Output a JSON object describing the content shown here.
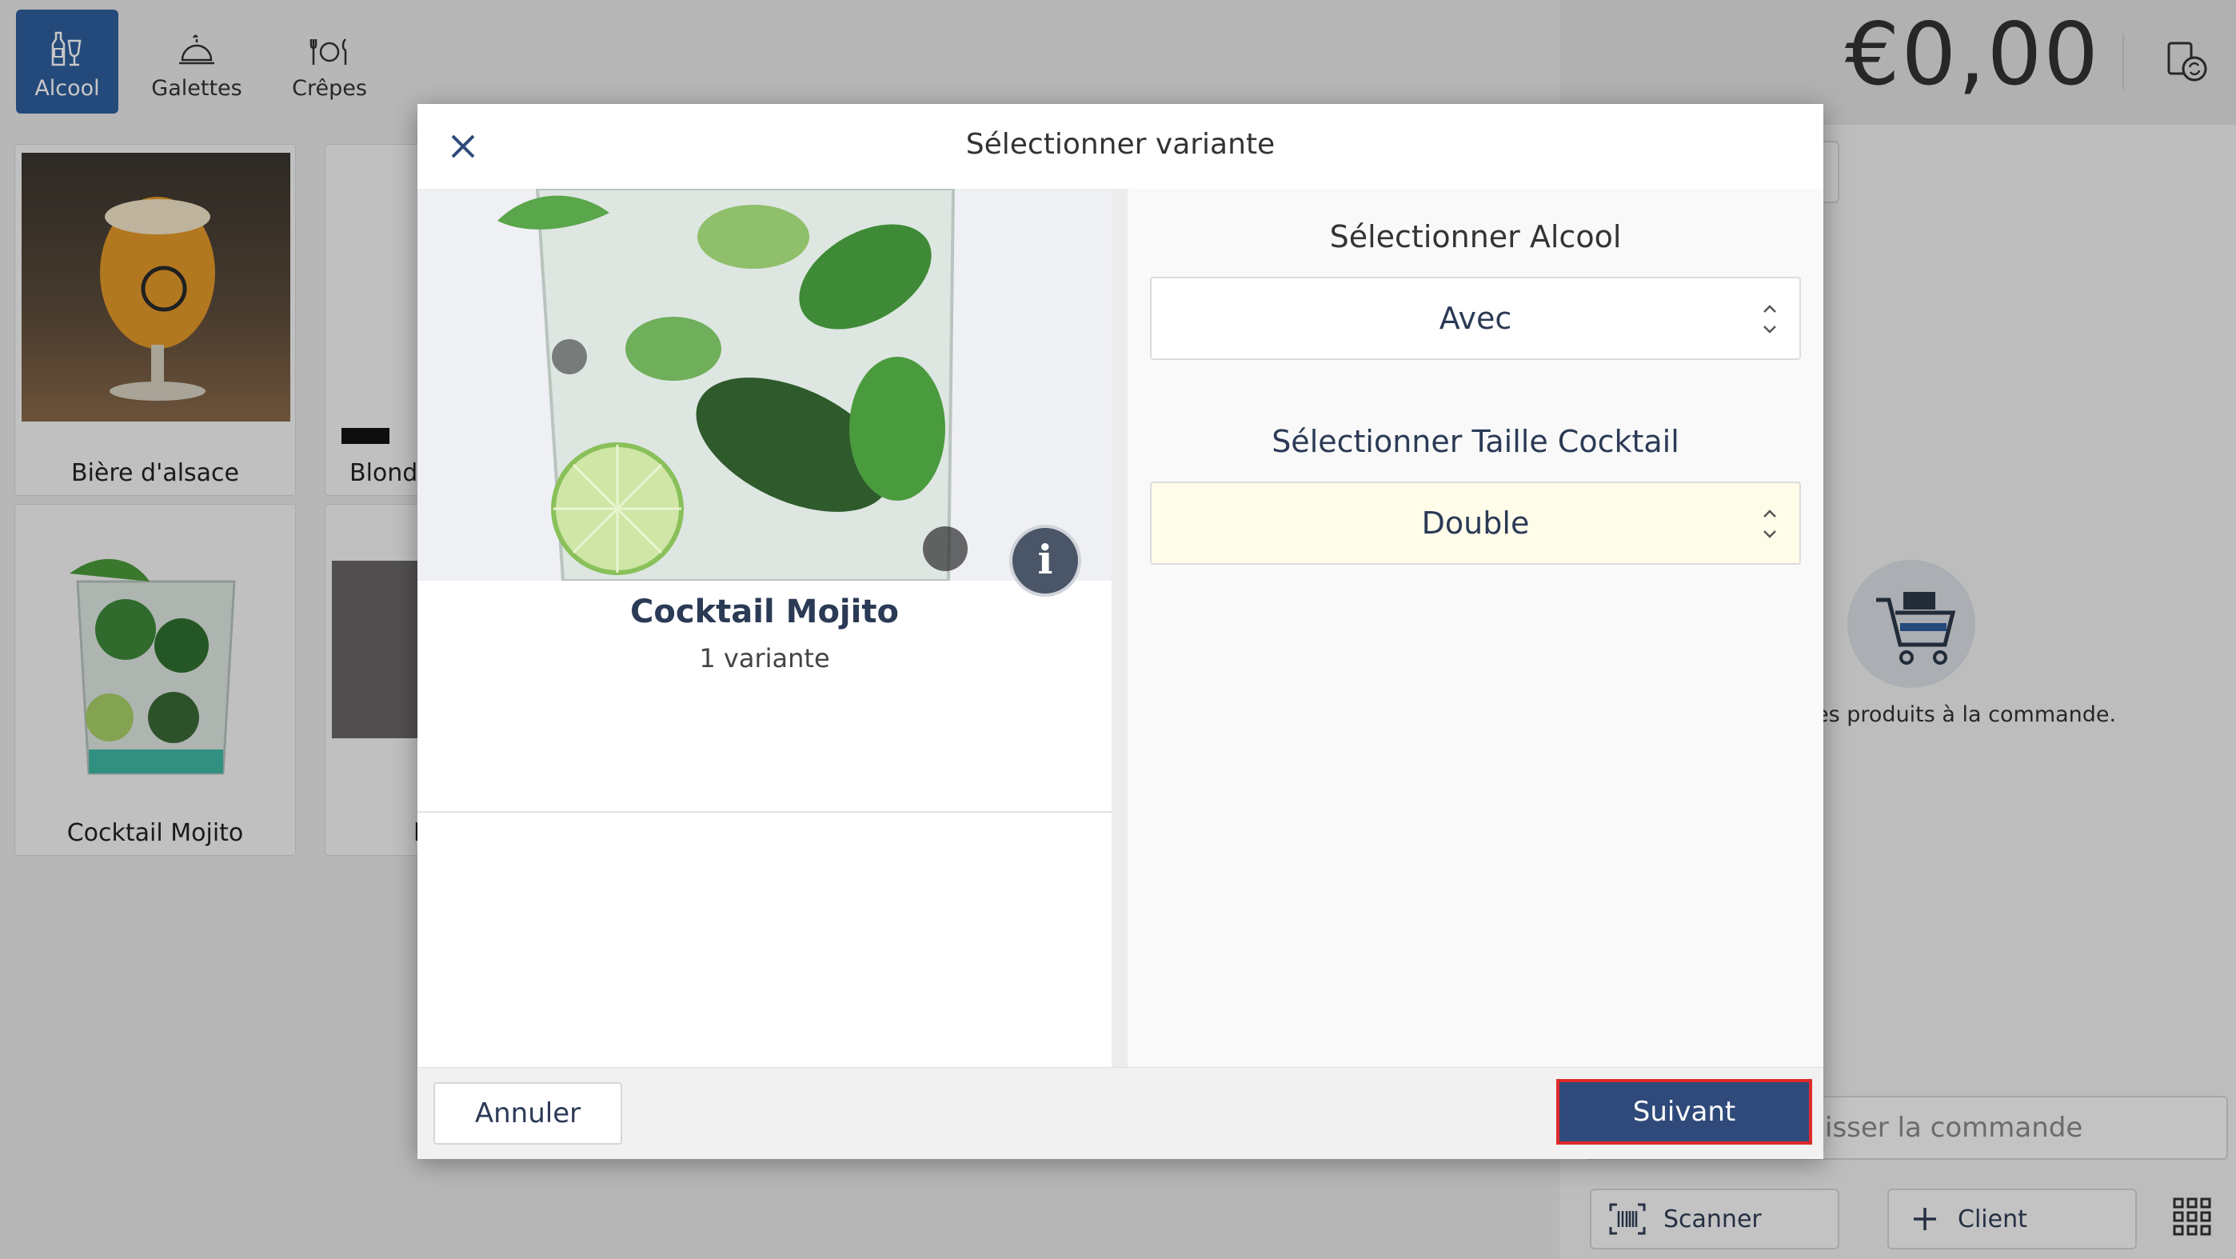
{
  "categories": [
    {
      "label": "Alcool",
      "icon": "bottle-glass-icon",
      "active": true
    },
    {
      "label": "Galettes",
      "icon": "cloche-icon",
      "active": false
    },
    {
      "label": "Crêpes",
      "icon": "cutlery-plate-icon",
      "active": false
    }
  ],
  "products": [
    {
      "label": "Bière d'alsace"
    },
    {
      "label": "Blonde"
    },
    {
      "label": "Cocktail Mojito"
    },
    {
      "label": "l"
    }
  ],
  "order": {
    "amount": "€0,00",
    "empty_hint": "es produits à la commande.",
    "finish_placeholder": "isser la commande",
    "scanner_label": "Scanner",
    "client_label": "Client"
  },
  "modal": {
    "title": "Sélectionner variante",
    "product_name": "Cocktail Mojito",
    "product_variants": "1 variante",
    "info_label": "i",
    "sections": [
      {
        "title": "Sélectionner Alcool",
        "value": "Avec"
      },
      {
        "title": "Sélectionner Taille Cocktail",
        "value": "Double"
      }
    ],
    "cancel_label": "Annuler",
    "next_label": "Suivant"
  },
  "colors": {
    "accent": "#2f5f9e",
    "next_button": "#2f4a7a",
    "highlight_border": "#e02b2b",
    "selected_field_bg": "#fffcea"
  }
}
